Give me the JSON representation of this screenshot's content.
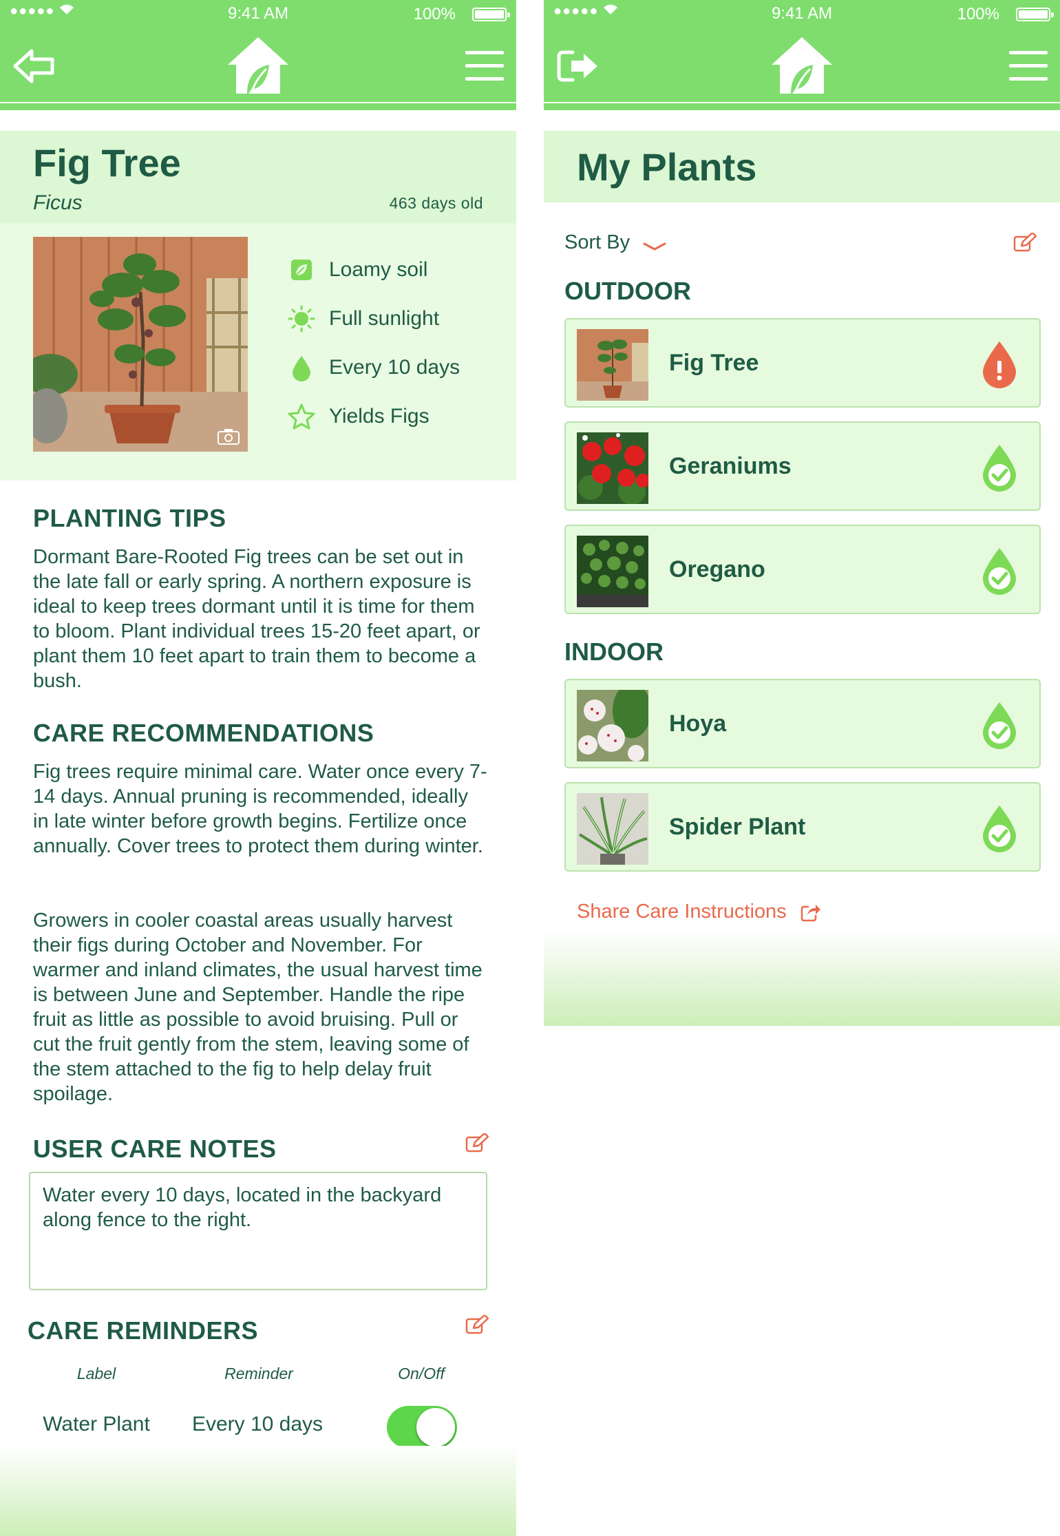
{
  "status_bar": {
    "signal": "●●●●●",
    "time": "9:41 AM",
    "battery": "100%"
  },
  "detail": {
    "title": "Fig Tree",
    "latin_name": "Ficus",
    "age": "463 days old",
    "attributes": [
      {
        "icon": "leaf-icon",
        "label": "Loamy soil"
      },
      {
        "icon": "sun-icon",
        "label": "Full sunlight"
      },
      {
        "icon": "water-drop-icon",
        "label": "Every 10 days"
      },
      {
        "icon": "star-icon",
        "label": "Yields Figs"
      }
    ],
    "planting_tips": {
      "title": "PLANTING TIPS",
      "text": "Dormant Bare-Rooted Fig trees can be set out in the late fall or early spring.  A northern exposure is ideal to keep trees dormant until it is time for them to bloom.  Plant individual trees 15-20 feet apart, or plant them 10 feet apart to train them to become a bush."
    },
    "care_recommendations": {
      "title": "CARE RECOMMENDATIONS",
      "text1": "Fig trees require minimal care.  Water once every 7-14 days.  Annual pruning is recommended, ideally in late winter before growth begins.  Fertilize once annually.  Cover trees to protect them during winter.",
      "text2": "Growers in cooler coastal areas usually harvest their figs during October and November. For warmer and inland climates, the usual harvest time is between June and September.   Handle the ripe fruit as little as possible to avoid bruising. Pull or cut the fruit gently from the stem, leaving some of the stem attached to the fig to help delay fruit spoilage."
    },
    "user_care_notes": {
      "title": "USER CARE NOTES",
      "value": "Water every 10 days, located in the backyard along fence to the right."
    },
    "care_reminders": {
      "title": "CARE REMINDERS",
      "headers": {
        "label": "Label",
        "reminder": "Reminder",
        "onoff": "On/Off"
      },
      "rows": [
        {
          "label": "Water Plant",
          "reminder": "Every 10 days",
          "enabled": true
        }
      ]
    }
  },
  "my_plants": {
    "title": "My Plants",
    "sort_by": "Sort By",
    "groups": [
      {
        "title": "OUTDOOR",
        "plants": [
          {
            "name": "Fig Tree",
            "status": "alert"
          },
          {
            "name": "Geraniums",
            "status": "ok"
          },
          {
            "name": "Oregano",
            "status": "ok"
          }
        ]
      },
      {
        "title": "INDOOR",
        "plants": [
          {
            "name": "Hoya",
            "status": "ok"
          },
          {
            "name": "Spider Plant",
            "status": "ok"
          }
        ]
      }
    ],
    "share_label": "Share Care Instructions"
  },
  "colors": {
    "accent_green": "#7fdd6e",
    "text_green": "#1f5b45",
    "alert_orange": "#e96a4b",
    "ok_green": "#7ed957",
    "toggle_green": "#5ed64b"
  }
}
